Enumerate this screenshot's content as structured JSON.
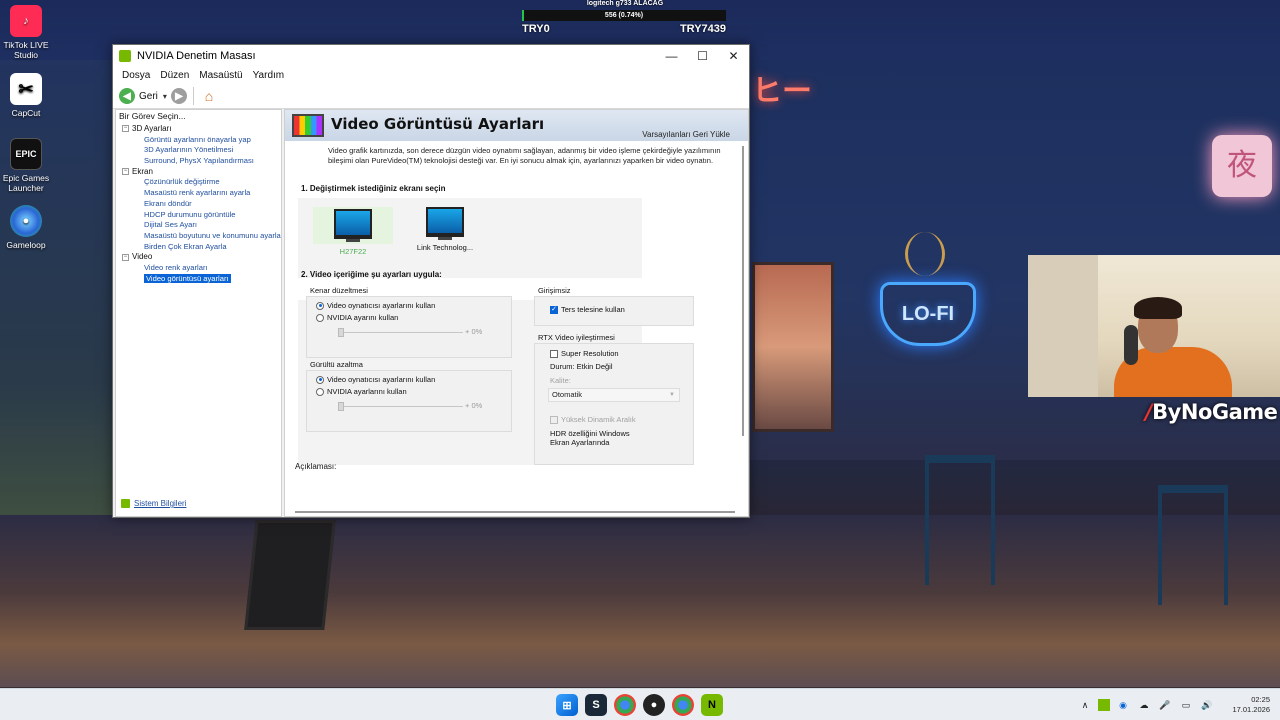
{
  "desktop": {
    "icons": [
      {
        "label_line1": "TikTok LIVE",
        "label_line2": "Studio",
        "glyph": "♪"
      },
      {
        "label_line1": "CapCut",
        "label_line2": "",
        "glyph": "✂"
      },
      {
        "label_line1": "Epic Games",
        "label_line2": "Launcher",
        "glyph": "EPIC"
      },
      {
        "label_line1": "Gameloop",
        "label_line2": "",
        "glyph": "●"
      }
    ]
  },
  "stream_overlay": {
    "goal_title": "logitech g733 ALACAĞ",
    "goal_amount": "556 (0.74%)",
    "goal_progress": 0.0074,
    "left_label": "TRY0",
    "right_label": "TRY7439",
    "brand": "ByNoGame",
    "neon_sign": "夜",
    "neon_top": "ヒー",
    "cafe_sign": "LO-FI"
  },
  "window": {
    "title": "NVIDIA Denetim Masası",
    "controls": {
      "minimize": "—",
      "maximize": "☐",
      "close": "✕"
    },
    "menu": [
      "Dosya",
      "Düzen",
      "Masaüstü",
      "Yardım"
    ],
    "toolbar": {
      "back_label": "Geri",
      "dropdown": "▾",
      "back_glyph": "◀",
      "forward_glyph": "▶",
      "home_glyph": "⌂"
    },
    "left_pane": {
      "title": "Bir Görev Seçin...",
      "tree": [
        {
          "label": "3D Ayarları",
          "items": [
            "Görüntü ayarlarını önayarla yap",
            "3D Ayarlarının Yönetilmesi",
            "Surround, PhysX Yapılandırması"
          ]
        },
        {
          "label": "Ekran",
          "items": [
            "Çözünürlük değiştirme",
            "Masaüstü renk ayarlarını ayarla",
            "Ekranı döndür",
            "HDCP durumunu görüntüle",
            "Dijital Ses Ayarı",
            "Masaüstü boyutunu ve konumunu ayarla",
            "Birden Çok Ekran Ayarla"
          ]
        },
        {
          "label": "Video",
          "items": [
            "Video renk ayarları",
            "Video görüntüsü ayarları"
          ]
        }
      ],
      "expand_glyph": "−",
      "system_info": "Sistem Bilgileri"
    },
    "right_pane": {
      "title": "Video Görüntüsü Ayarları",
      "restore_defaults": "Varsayılanları Geri Yükle",
      "description": "Video grafik kartınızda, son derece düzgün video oynatımı sağlayan, adanmış bir video işleme çekirdeğiyle yazılımının bileşimi olan PureVideo(TM) teknolojisi desteği var. En iyi sonucu almak için, ayarlarınızı yaparken bir video oynatın.",
      "section1": "1. Değiştirmek istediğiniz ekranı seçin",
      "displays": [
        {
          "name": "H27F22",
          "active": true
        },
        {
          "name": "Link Technolog...",
          "active": false
        }
      ],
      "section2": "2. Video içeriğime şu ayarları uygula:",
      "edge": {
        "title": "Kenar düzeltmesi",
        "option1": "Video oynatıcısı ayarlarını kullan",
        "option2": "NVIDIA ayarını kullan",
        "value": "+ 0%"
      },
      "noise": {
        "title": "Gürültü azaltma",
        "option1": "Video oynatıcısı ayarlarını kullan",
        "option2": "NVIDIA ayarlarını kullan",
        "value": "+ 0%"
      },
      "interlace": {
        "title": "Girişimsiz",
        "checkbox": "Ters telesine kullan",
        "checked": true
      },
      "rtx": {
        "title": "RTX Video iyileştirmesi",
        "super_resolution": "Super Resolution",
        "status": "Durum: Etkin Değil",
        "quality_label": "Kalite:",
        "quality_value": "Otomatik",
        "hdr_checkbox": "Yüksek Dinamik Aralık",
        "hdr_note": "HDR özelliğini Windows Ekran Ayarlarında"
      },
      "aciklama": "Açıklaması:"
    }
  },
  "taskbar": {
    "apps": [
      {
        "name": "start",
        "glyph": "⊞"
      },
      {
        "name": "steam",
        "glyph": "S"
      },
      {
        "name": "chrome",
        "glyph": ""
      },
      {
        "name": "ball",
        "glyph": "●"
      },
      {
        "name": "chrome-profile",
        "glyph": ""
      },
      {
        "name": "nvidia",
        "glyph": "N"
      }
    ],
    "tray": {
      "chevron": "∧",
      "time": "02:25",
      "date": "17.01.2026"
    }
  }
}
